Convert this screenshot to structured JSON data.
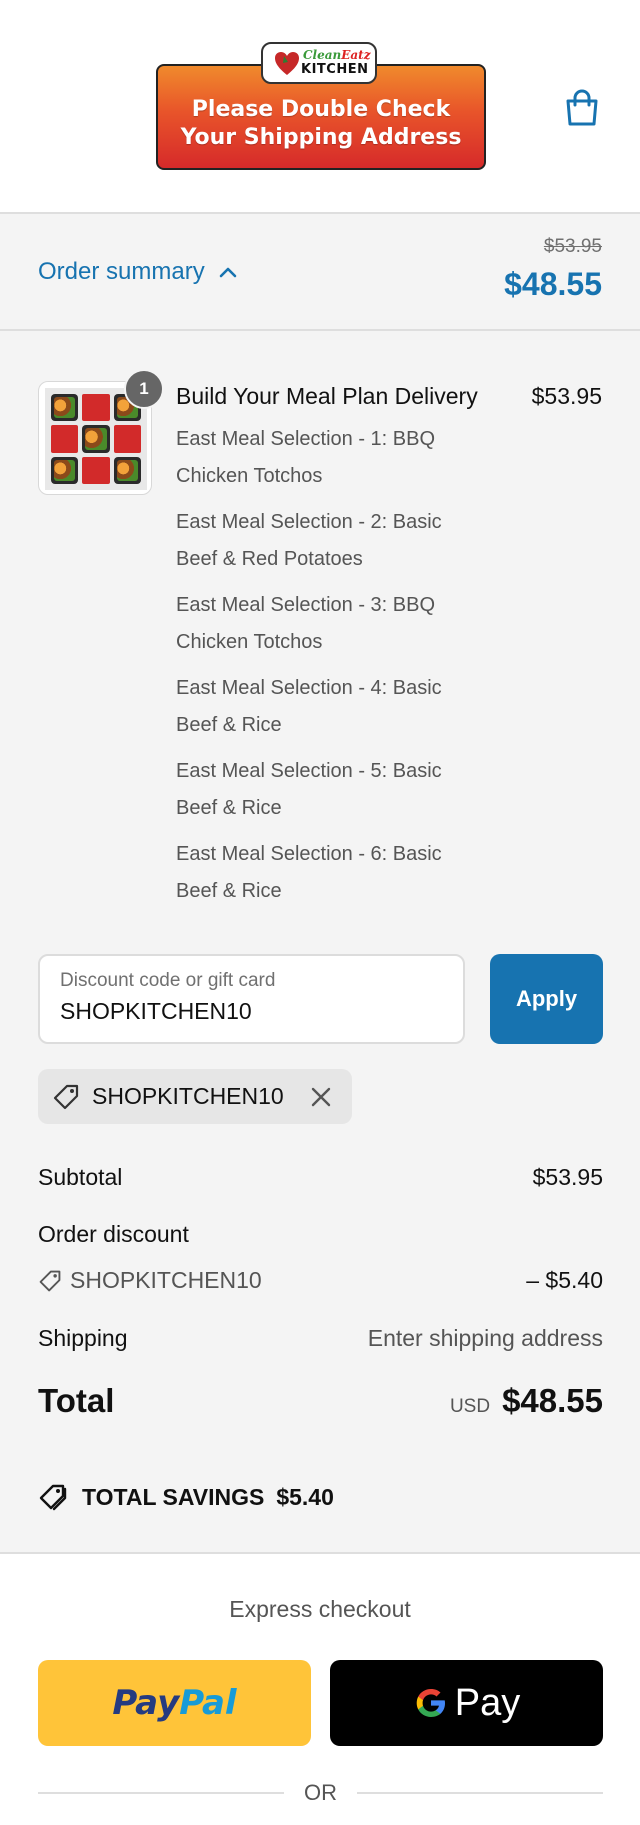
{
  "header": {
    "logo_top_green": "Clean",
    "logo_top_red": "Eatz",
    "logo_bottom": "KITCHEN",
    "banner_line1": "Please Double Check",
    "banner_line2": "Your Shipping Address",
    "cart_icon": "shopping-bag-icon"
  },
  "summary": {
    "toggle_label": "Order summary",
    "original_price": "$53.95",
    "current_price": "$48.55"
  },
  "item": {
    "quantity": "1",
    "title": "Build Your Meal Plan Delivery",
    "price": "$53.95",
    "selections": [
      "East Meal Selection - 1: BBQ Chicken Totchos",
      "East Meal Selection - 2: Basic Beef & Red Potatoes",
      "East Meal Selection - 3: BBQ Chicken Totchos",
      "East Meal Selection - 4: Basic Beef & Rice",
      "East Meal Selection - 5: Basic Beef & Rice",
      "East Meal Selection - 6: Basic Beef & Rice"
    ]
  },
  "discount": {
    "placeholder": "Discount code or gift card",
    "value": "SHOPKITCHEN10",
    "apply_label": "Apply",
    "applied_code": "SHOPKITCHEN10"
  },
  "totals": {
    "subtotal_label": "Subtotal",
    "subtotal_value": "$53.95",
    "order_discount_label": "Order discount",
    "discount_code": "SHOPKITCHEN10",
    "discount_value": "– $5.40",
    "shipping_label": "Shipping",
    "shipping_value": "Enter shipping address",
    "total_label": "Total",
    "currency": "USD",
    "total_value": "$48.55",
    "savings_label": "TOTAL SAVINGS",
    "savings_value": "$5.40"
  },
  "express": {
    "title": "Express checkout",
    "paypal_pay": "Pay",
    "paypal_pal": "Pal",
    "gpay_label": "Pay",
    "or_label": "OR"
  },
  "colors": {
    "accent": "#1773b0",
    "paypal_yellow": "#ffc439",
    "banner_orange": "#f08a2c",
    "banner_red": "#d62a2a"
  }
}
